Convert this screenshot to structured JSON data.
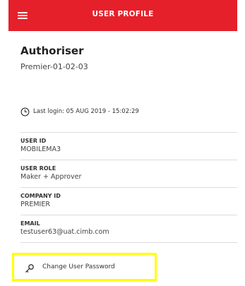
{
  "header": {
    "title": "USER PROFILE",
    "menu_icon": "hamburger-menu-icon",
    "background_color": "#e5202a"
  },
  "profile": {
    "name": "Authoriser",
    "code": "Premier-01-02-03",
    "last_login_icon": "clock-icon",
    "last_login": "Last login: 05 AUG 2019 - 15:02:29"
  },
  "details": [
    {
      "label": "USER ID",
      "value": "MOBILEMA3"
    },
    {
      "label": "USER ROLE",
      "value": "Maker + Approver"
    },
    {
      "label": "COMPANY ID",
      "value": "PREMIER"
    },
    {
      "label": "EMAIL",
      "value": "testuser63@uat.cimb.com"
    }
  ],
  "actions": {
    "change_password_label": "Change User Password",
    "change_password_icon": "key-icon",
    "highlight_color": "#ffff00"
  }
}
